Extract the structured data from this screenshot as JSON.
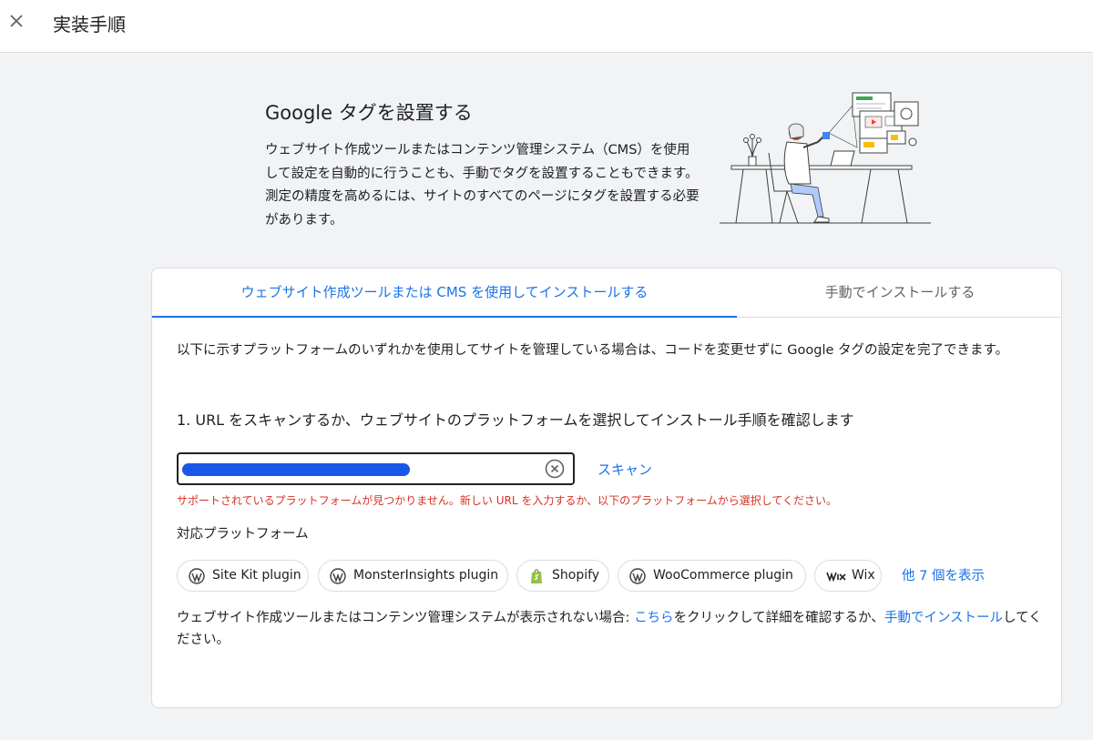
{
  "topbar": {
    "title": "実装手順",
    "close_icon": "close-icon"
  },
  "hero": {
    "title": "Google タグを設置する",
    "description": "ウェブサイト作成ツールまたはコンテンツ管理システム（CMS）を使用して設定を自動的に行うことも、手動でタグを設置することもできます。測定の精度を高めるには、サイトのすべてのページにタグを設置する必要があります。",
    "illustration": "person-at-desk-illustration"
  },
  "tabs": [
    {
      "label": "ウェブサイト作成ツールまたは CMS を使用してインストールする",
      "active": true
    },
    {
      "label": "手動でインストールする",
      "active": false
    }
  ],
  "content": {
    "intro": "以下に示すプラットフォームのいずれかを使用してサイトを管理している場合は、コードを変更せずに Google タグの設定を完了できます。",
    "step1": "1. URL をスキャンするか、ウェブサイトのプラットフォームを選択してインストール手順を確認します",
    "url_input": {
      "value": "",
      "placeholder": "",
      "clear_icon": "clear-circle-icon"
    },
    "scan_label": "スキャン",
    "error": "サポートされているプラットフォームが見つかりません。新しい URL を入力するか、以下のプラットフォームから選択してください。",
    "platforms_label": "対応プラットフォーム",
    "platforms": [
      {
        "label": "Site Kit plugin",
        "icon": "wordpress-icon"
      },
      {
        "label": "MonsterInsights plugin",
        "icon": "wordpress-icon"
      },
      {
        "label": "Shopify",
        "icon": "shopify-icon"
      },
      {
        "label": "WooCommerce plugin",
        "icon": "wordpress-icon"
      },
      {
        "label": "Wix",
        "icon": "wix-icon"
      }
    ],
    "more_label": "他 7 個を表示",
    "footer": {
      "before": "ウェブサイト作成ツールまたはコンテンツ管理システムが表示されない場合: ",
      "link1": "こちら",
      "middle": "をクリックして詳細を確認するか、",
      "link2": "手動でインストール",
      "after": "してください。"
    }
  },
  "colors": {
    "accent": "#1a73e8",
    "error": "#d93025",
    "background": "#f1f3f4",
    "shopify": "#95bf47"
  }
}
